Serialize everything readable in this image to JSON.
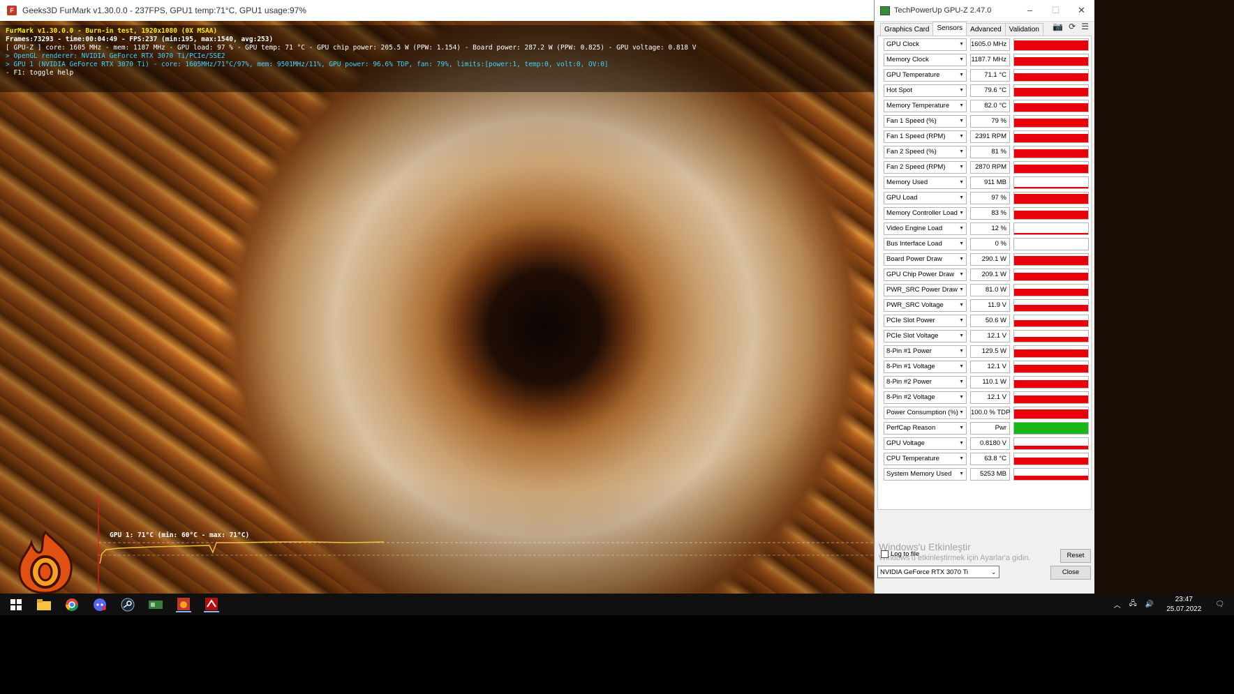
{
  "furmark": {
    "title": "Geeks3D FurMark v1.30.0.0 - 237FPS, GPU1 temp:71°C, GPU1 usage:97%",
    "overlay": {
      "line1": "FurMark v1.30.0.0 - Burn-in test, 1920x1080 (0X MSAA)",
      "line2": "Frames:73293 - time:00:04:49 - FPS:237 (min:195, max:1540, avg:253)",
      "line3": "[ GPU-Z ] core: 1605 MHz - mem: 1187 MHz - GPU load: 97 % - GPU temp: 71 °C - GPU chip power: 205.5 W (PPW: 1.154) - Board power: 287.2 W (PPW: 0.825) - GPU voltage: 0.818 V",
      "line4": "> OpenGL renderer: NVIDIA GeForce RTX 3070 Ti/PCIe/SSE2",
      "line5": "> GPU 1 (NVIDIA GeForce RTX 3070 Ti) - core: 1605MHz/71°C/97%, mem: 9501MHz/11%, GPU power: 96.6% TDP, fan: 79%, limits:[power:1, temp:0, volt:0, OV:0]",
      "line6": "- F1: toggle help"
    },
    "graph_label": "GPU 1: 71°C (min: 60°C - max: 71°C)"
  },
  "gpuz": {
    "title": "TechPowerUp GPU-Z 2.47.0",
    "tabs": [
      "Graphics Card",
      "Sensors",
      "Advanced",
      "Validation"
    ],
    "active_tab": "Sensors",
    "sensors": [
      {
        "name": "GPU Clock",
        "value": "1605.0 MHz",
        "level": 0.9,
        "color": "#e8000a"
      },
      {
        "name": "Memory Clock",
        "value": "1187.7 MHz",
        "level": 0.75,
        "color": "#e8000a"
      },
      {
        "name": "GPU Temperature",
        "value": "71.1 °C",
        "level": 0.7,
        "color": "#e8000a"
      },
      {
        "name": "Hot Spot",
        "value": "79.6 °C",
        "level": 0.72,
        "color": "#e8000a"
      },
      {
        "name": "Memory Temperature",
        "value": "82.0 °C",
        "level": 0.75,
        "color": "#e8000a"
      },
      {
        "name": "Fan 1 Speed (%)",
        "value": "79 %",
        "level": 0.72,
        "color": "#e8000a"
      },
      {
        "name": "Fan 1 Speed (RPM)",
        "value": "2391 RPM",
        "level": 0.72,
        "color": "#e8000a"
      },
      {
        "name": "Fan 2 Speed (%)",
        "value": "81 %",
        "level": 0.72,
        "color": "#e8000a"
      },
      {
        "name": "Fan 2 Speed (RPM)",
        "value": "2870 RPM",
        "level": 0.72,
        "color": "#e8000a"
      },
      {
        "name": "Memory Used",
        "value": "911 MB",
        "level": 0.1,
        "color": "#e8000a"
      },
      {
        "name": "GPU Load",
        "value": "97 %",
        "level": 0.85,
        "color": "#e8000a"
      },
      {
        "name": "Memory Controller Load",
        "value": "83 %",
        "level": 0.75,
        "color": "#e8000a"
      },
      {
        "name": "Video Engine Load",
        "value": "12 %",
        "level": 0.12,
        "color": "#e8000a"
      },
      {
        "name": "Bus Interface Load",
        "value": "0 %",
        "level": 0.0,
        "color": "#e8000a"
      },
      {
        "name": "Board Power Draw",
        "value": "290.1 W",
        "level": 0.8,
        "color": "#e8000a"
      },
      {
        "name": "GPU Chip Power Draw",
        "value": "209.1 W",
        "level": 0.7,
        "color": "#e8000a"
      },
      {
        "name": "PWR_SRC Power Draw",
        "value": "81.0 W",
        "level": 0.6,
        "color": "#e8000a"
      },
      {
        "name": "PWR_SRC Voltage",
        "value": "11.9 V",
        "level": 0.55,
        "color": "#e8000a"
      },
      {
        "name": "PCIe Slot Power",
        "value": "50.6 W",
        "level": 0.55,
        "color": "#e8000a"
      },
      {
        "name": "PCIe Slot Voltage",
        "value": "12.1 V",
        "level": 0.45,
        "color": "#e8000a"
      },
      {
        "name": "8-Pin #1 Power",
        "value": "129.5 W",
        "level": 0.7,
        "color": "#e8000a"
      },
      {
        "name": "8-Pin #1 Voltage",
        "value": "12.1 V",
        "level": 0.7,
        "color": "#e8000a"
      },
      {
        "name": "8-Pin #2 Power",
        "value": "110.1 W",
        "level": 0.7,
        "color": "#e8000a"
      },
      {
        "name": "8-Pin #2 Voltage",
        "value": "12.1 V",
        "level": 0.7,
        "color": "#e8000a"
      },
      {
        "name": "Power Consumption (%)",
        "value": "100.0 % TDP",
        "level": 0.8,
        "color": "#e8000a"
      },
      {
        "name": "PerfCap Reason",
        "value": "Pwr",
        "level": 1.0,
        "color": "#18b618"
      },
      {
        "name": "GPU Voltage",
        "value": "0.8180 V",
        "level": 0.3,
        "color": "#e8000a"
      },
      {
        "name": "CPU Temperature",
        "value": "63.8 °C",
        "level": 0.6,
        "color": "#e8000a"
      },
      {
        "name": "System Memory Used",
        "value": "5253 MB",
        "level": 0.35,
        "color": "#e8000a"
      }
    ],
    "log_label": "Log to file",
    "reset_label": "Reset",
    "gpu_selected": "NVIDIA GeForce RTX 3070 Ti",
    "close_label": "Close",
    "watermark_title": "Windows'u Etkinleştir",
    "watermark_sub": "Windows'u etkinleştirmek için Ayarlar'a gidin."
  },
  "taskbar": {
    "time": "23:47",
    "date": "25.07.2022",
    "apps": [
      "start-icon",
      "file-explorer-icon",
      "chrome-icon",
      "discord-icon",
      "steam-icon",
      "gpuz-taskbar-icon",
      "furmark-taskbar-icon",
      "msi-afterburner-icon"
    ]
  }
}
